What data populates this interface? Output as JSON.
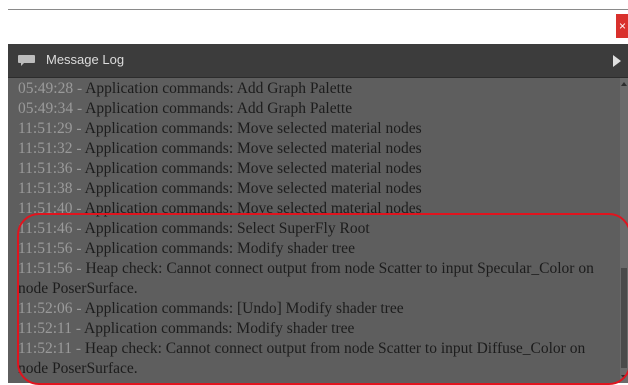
{
  "window": {
    "close_label": "×"
  },
  "panel": {
    "title": "Message Log",
    "icons": {
      "title_icon": "chat-bubble-icon",
      "expand_icon": "triangle-right-icon"
    }
  },
  "log": {
    "separator": "-",
    "entries": [
      {
        "time": "05:49:28",
        "text": "Application commands: Add Graph Palette"
      },
      {
        "time": "05:49:34",
        "text": "Application commands: Add Graph Palette"
      },
      {
        "time": "11:51:29",
        "text": "Application commands: Move selected material nodes"
      },
      {
        "time": "11:51:32",
        "text": "Application commands: Move selected material nodes"
      },
      {
        "time": "11:51:36",
        "text": "Application commands: Move selected material nodes"
      },
      {
        "time": "11:51:38",
        "text": "Application commands: Move selected material nodes"
      },
      {
        "time": "11:51:40",
        "text": "Application commands: Move selected material nodes"
      },
      {
        "time": "11:51:46",
        "text": "Application commands: Select SuperFly Root"
      },
      {
        "time": "11:51:56",
        "text": "Application commands: Modify shader tree"
      },
      {
        "time": "11:51:56",
        "text": "Heap check: Cannot connect output from node Scatter to input Specular_Color on node PoserSurface."
      },
      {
        "time": "11:52:06",
        "text": "Application commands: [Undo] Modify shader tree"
      },
      {
        "time": "11:52:11",
        "text": "Application commands: Modify shader tree"
      },
      {
        "time": "11:52:11",
        "text": "Heap check: Cannot connect output from node Scatter to input Diffuse_Color on node PoserSurface."
      }
    ]
  },
  "colors": {
    "timestamp": "#9a9a9a",
    "command_text": "#1c1c1c",
    "panel_bg": "#5e5e5e",
    "header_bg": "#3c3c3c",
    "highlight": "#e0141e",
    "close_button": "#d9302c"
  }
}
